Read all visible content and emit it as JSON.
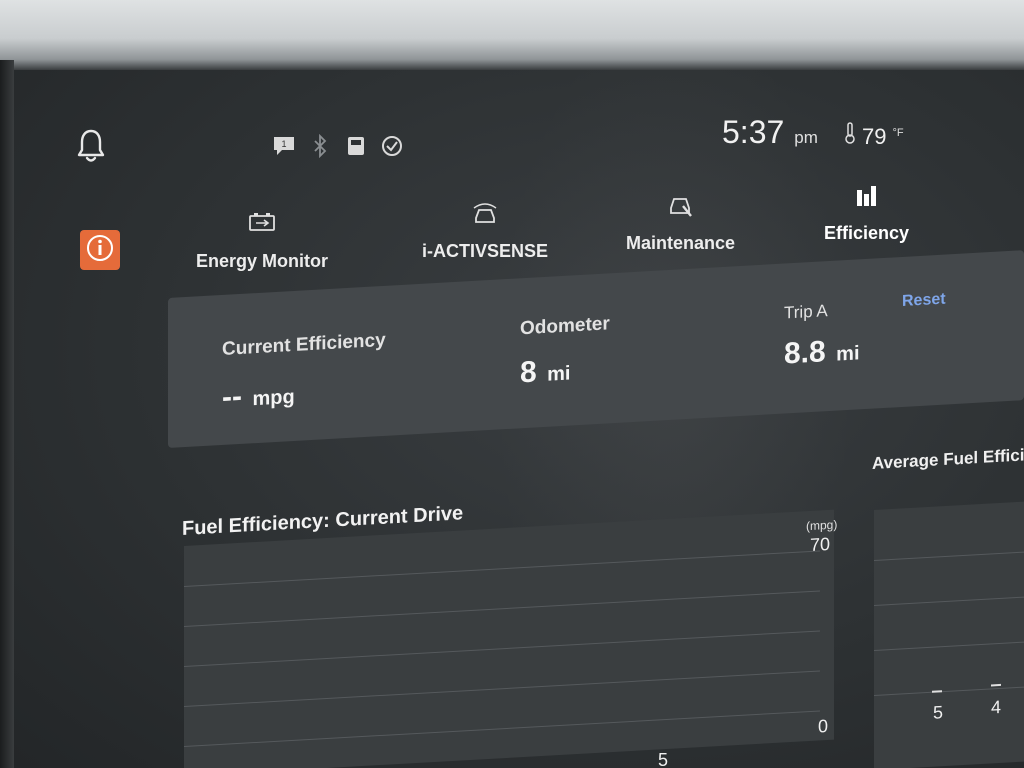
{
  "status_bar": {
    "time": "5:37",
    "ampm": "pm",
    "temperature": "79",
    "temperature_unit": "°F",
    "icons": [
      "bell-icon",
      "message-icon",
      "bluetooth-icon",
      "battery-icon",
      "check-circle-icon",
      "thermometer-icon"
    ],
    "message_badge": "1"
  },
  "tabs": [
    {
      "label": "Energy Monitor",
      "icon": "battery-swap-icon"
    },
    {
      "label": "i-ACTIVSENSE",
      "icon": "car-sensor-icon"
    },
    {
      "label": "Maintenance",
      "icon": "car-wrench-icon"
    },
    {
      "label": "Efficiency",
      "icon": "bar-chart-icon",
      "active": true
    }
  ],
  "summary": {
    "current_efficiency_label": "Current Efficiency",
    "current_efficiency_value": "--",
    "current_efficiency_unit": "mpg",
    "odometer_label": "Odometer",
    "odometer_value": "8",
    "odometer_unit": "mi",
    "trip_label": "Trip A",
    "trip_value": "8.8",
    "trip_unit": "mi",
    "reset_label": "Reset"
  },
  "chart": {
    "title": "Fuel Efficiency: Current Drive",
    "unit": "(mpg)",
    "y_max": "70",
    "y_min": "0",
    "x_tick": "5"
  },
  "average": {
    "title": "Average Fuel Efficienc",
    "values": [
      "5",
      "4"
    ]
  },
  "colors": {
    "accent_info": "#e56b3a",
    "link": "#7fa6ea"
  }
}
